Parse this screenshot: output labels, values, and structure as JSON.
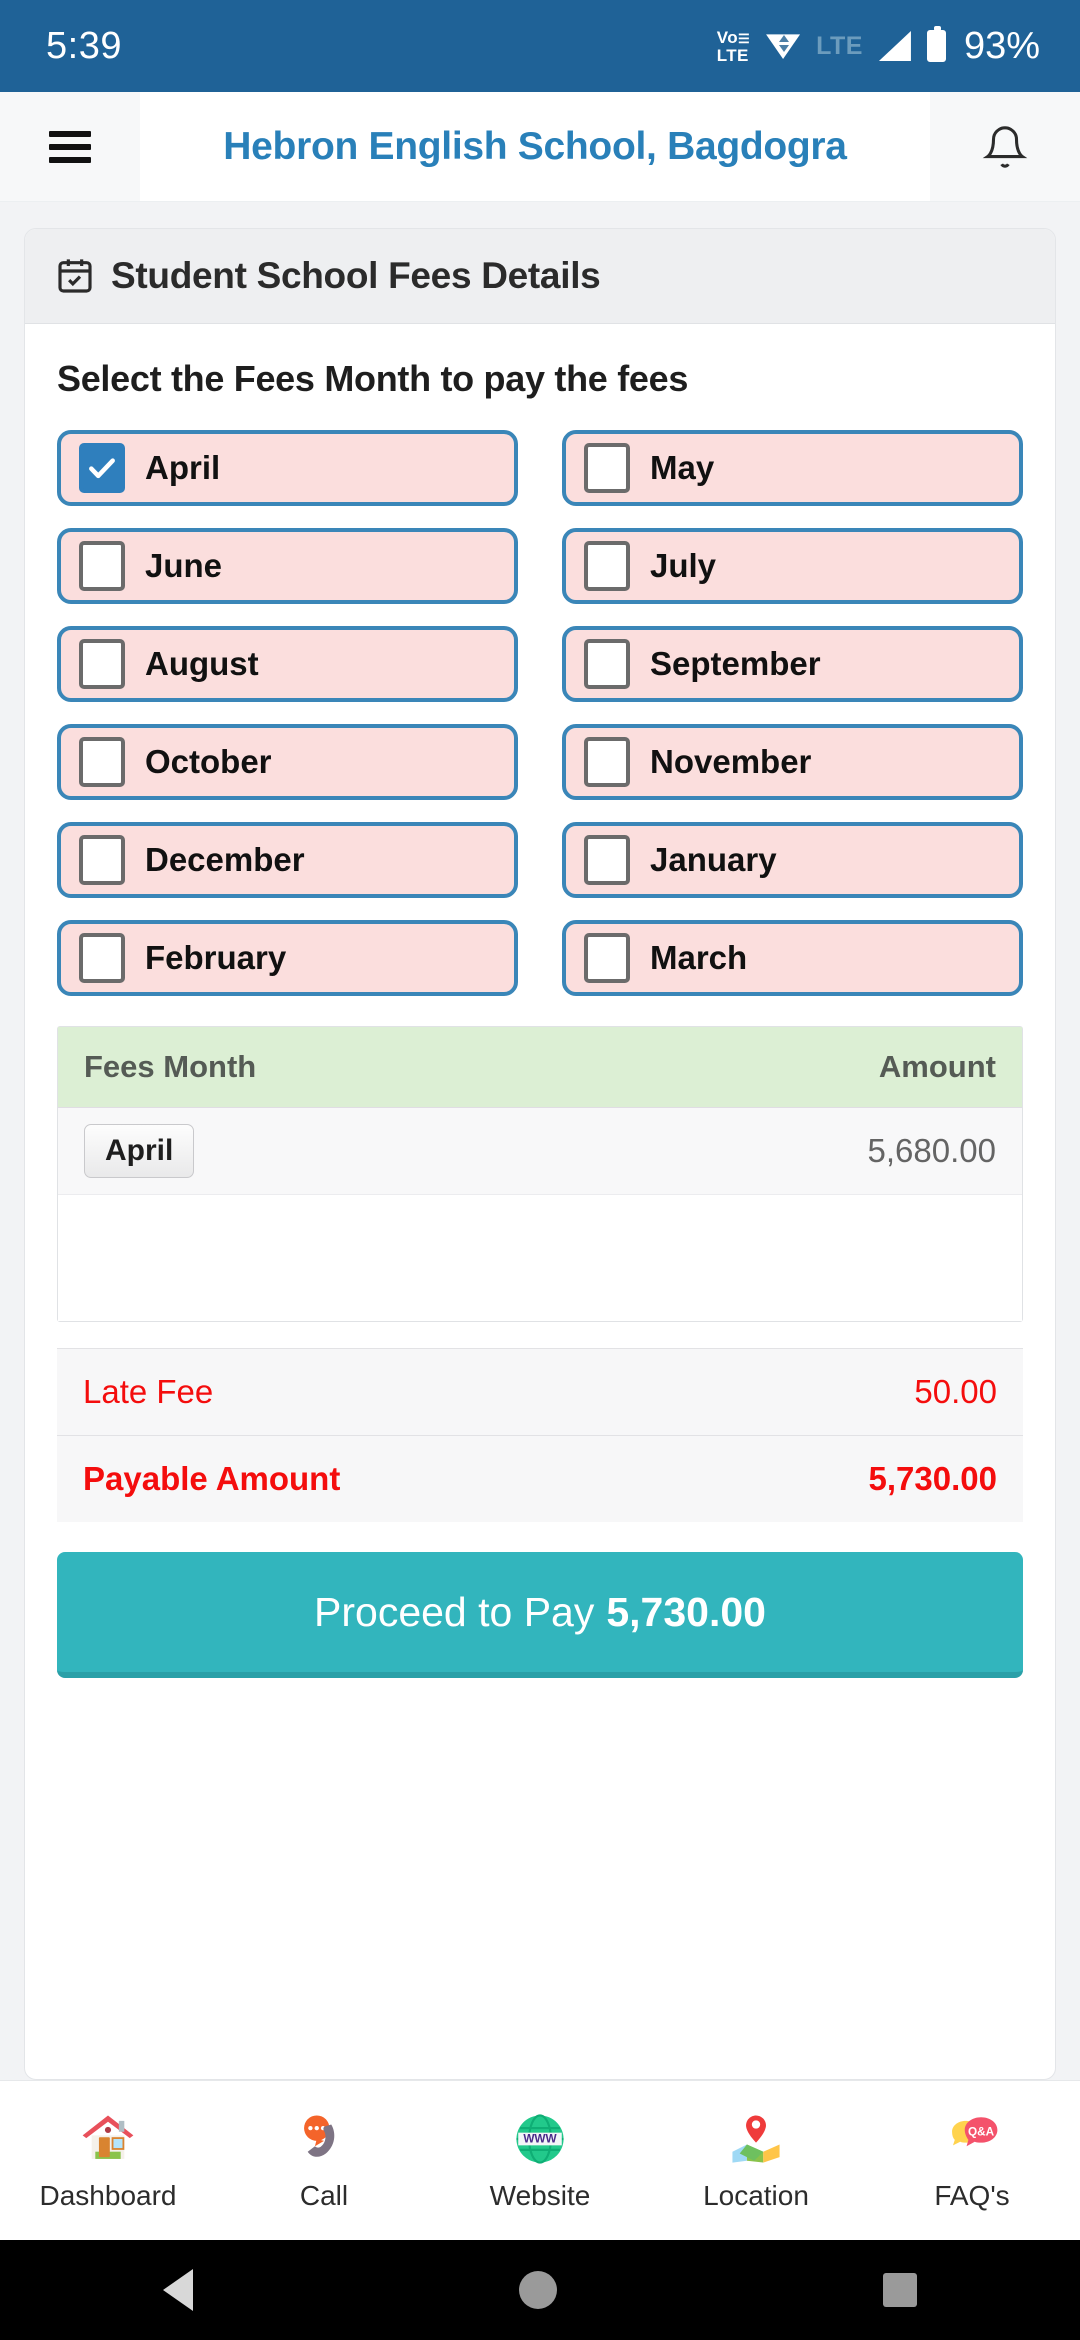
{
  "status_bar": {
    "time": "5:39",
    "volte": "Vo\nLTE",
    "network": "LTE",
    "battery": "93%",
    "icons": [
      "volte-icon",
      "wifi-calling-icon",
      "lte-icon",
      "signal-icon",
      "battery-icon"
    ]
  },
  "app_bar": {
    "menu_icon": "hamburger-menu-icon",
    "title": "Hebron English School, Bagdogra",
    "notification_icon": "bell-icon",
    "title_color": "#2980b9"
  },
  "card": {
    "header_icon": "calendar-check-icon",
    "header_title": "Student School Fees Details",
    "section_heading": "Select the Fees Month to pay the fees"
  },
  "months": [
    {
      "label": "April",
      "checked": true
    },
    {
      "label": "May",
      "checked": false
    },
    {
      "label": "June",
      "checked": false
    },
    {
      "label": "July",
      "checked": false
    },
    {
      "label": "August",
      "checked": false
    },
    {
      "label": "September",
      "checked": false
    },
    {
      "label": "October",
      "checked": false
    },
    {
      "label": "November",
      "checked": false
    },
    {
      "label": "December",
      "checked": false
    },
    {
      "label": "January",
      "checked": false
    },
    {
      "label": "February",
      "checked": false
    },
    {
      "label": "March",
      "checked": false
    }
  ],
  "fees_table": {
    "columns": [
      "Fees Month",
      "Amount"
    ],
    "rows": [
      {
        "month": "April",
        "amount": "5,680.00"
      }
    ]
  },
  "totals": [
    {
      "label": "Late Fee",
      "value": "50.00",
      "bold": false
    },
    {
      "label": "Payable Amount",
      "value": "5,730.00",
      "bold": true
    }
  ],
  "pay_button": {
    "label": "Proceed to Pay",
    "amount": "5,730.00",
    "color": "#32b5bd"
  },
  "bottom_nav": [
    {
      "label": "Dashboard",
      "icon": "home-icon"
    },
    {
      "label": "Call",
      "icon": "phone-chat-icon"
    },
    {
      "label": "Website",
      "icon": "globe-www-icon"
    },
    {
      "label": "Location",
      "icon": "map-pin-icon"
    },
    {
      "label": "FAQ's",
      "icon": "qa-bubble-icon"
    }
  ],
  "system_nav": {
    "back": "back-icon",
    "home": "home-circle-icon",
    "recents": "recents-icon"
  },
  "colors": {
    "status_bar": "#1f6297",
    "chip_border": "#3a86b8",
    "chip_fill": "#fbdedd",
    "table_head": "#dcefd4",
    "alert_red": "#f40d0d",
    "accent_teal": "#32b5bd"
  }
}
